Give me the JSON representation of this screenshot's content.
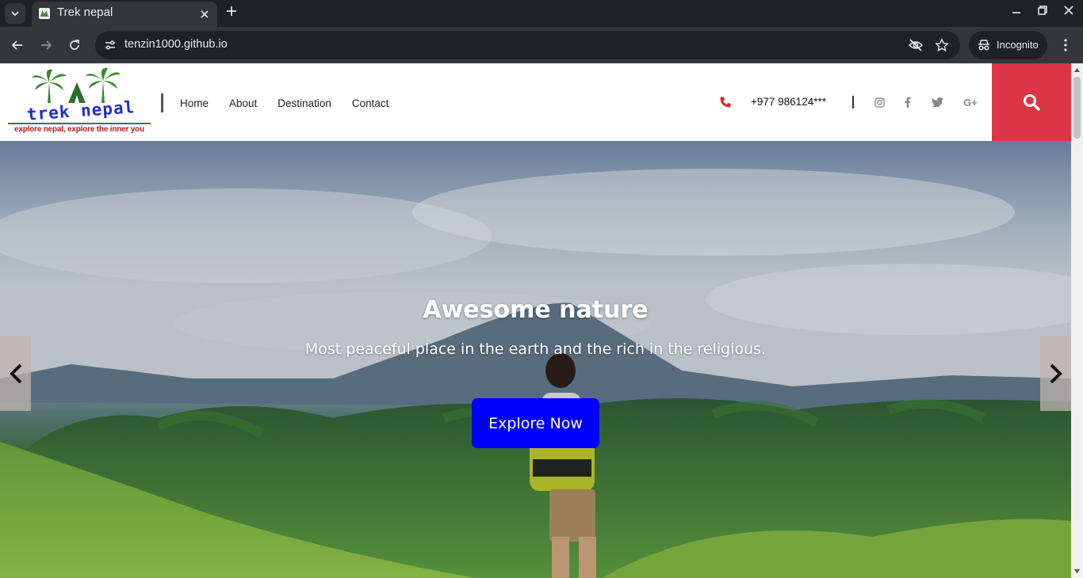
{
  "browser": {
    "tab_title": "Trek nepal",
    "url": "tenzin1000.github.io",
    "incognito_label": "Incognito"
  },
  "site": {
    "logo_text": "trek nepal",
    "logo_tagline": "explore nepal, explore the inner you",
    "nav": [
      "Home",
      "About",
      "Destination",
      "Contact"
    ],
    "phone": "+977 986124***",
    "social_icons": [
      "instagram-icon",
      "facebook-icon",
      "twitter-icon",
      "google-plus-icon"
    ],
    "google_plus_label": "G+",
    "accent_color": "#dc3545"
  },
  "hero": {
    "title": "Awesome nature",
    "subtitle": "Most peaceful place in the earth and the rich in the religious.",
    "button_label": "Explore Now",
    "button_color": "#0000ff"
  }
}
